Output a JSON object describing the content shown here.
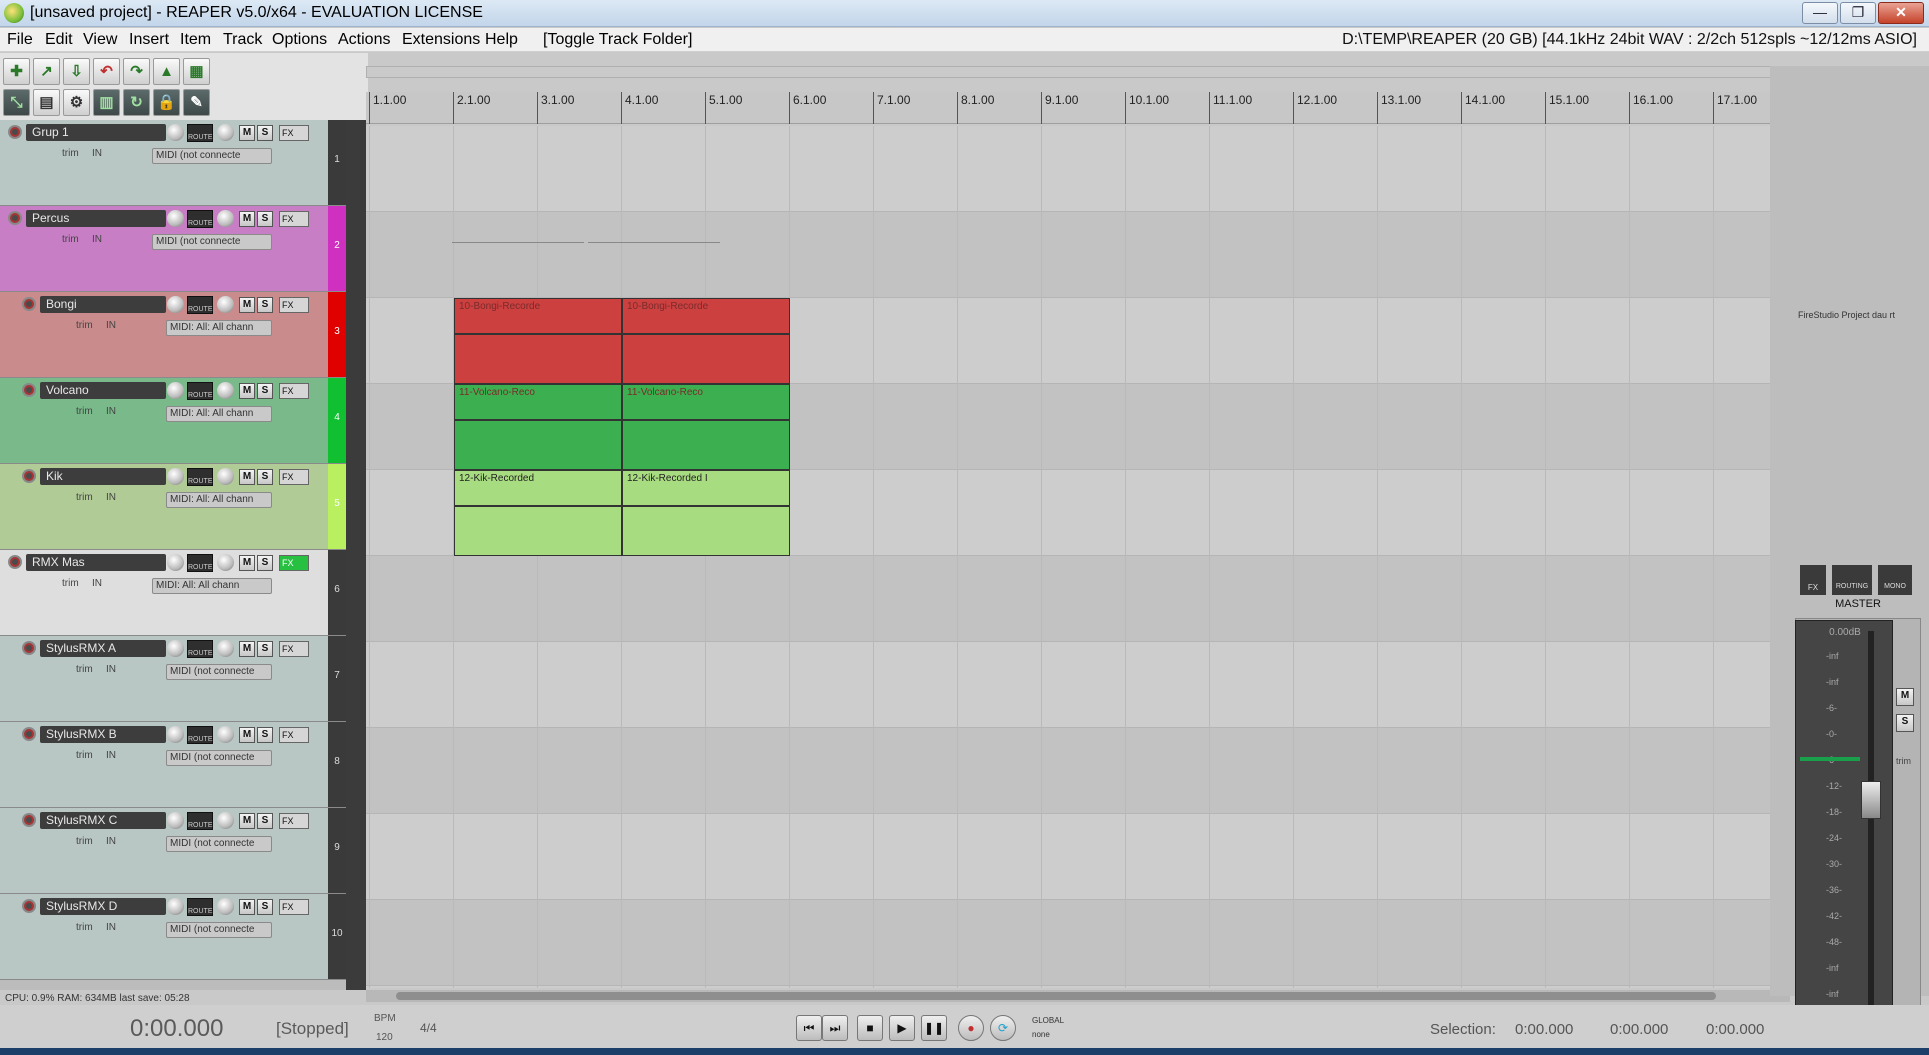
{
  "window": {
    "title": "[unsaved project] - REAPER v5.0/x64 - EVALUATION LICENSE",
    "buttons": {
      "minimize": "—",
      "maximize": "❐",
      "close": "✕"
    }
  },
  "menu": {
    "items": [
      "File",
      "Edit",
      "View",
      "Insert",
      "Item",
      "Track",
      "Options",
      "Actions",
      "Extensions",
      "Help",
      "[Toggle Track Folder]"
    ],
    "status": "D:\\TEMP\\REAPER (20 GB) [44.1kHz 24bit WAV : 2/2ch 512spls ~12/12ms ASIO]"
  },
  "ruler": {
    "labels": [
      "1.1.00",
      "2.1.00",
      "3.1.00",
      "4.1.00",
      "5.1.00",
      "6.1.00",
      "7.1.00",
      "8.1.00",
      "9.1.00",
      "10.1.00",
      "11.1.00",
      "12.1.00",
      "13.1.00",
      "14.1.00",
      "15.1.00",
      "16.1.00",
      "17.1.00"
    ]
  },
  "tracks": [
    {
      "name": "Grup 1",
      "number": "1",
      "input": "MIDI (not connecte",
      "color": "#b8c6c4",
      "bar": "#3a3a3a",
      "indent": 0
    },
    {
      "name": "Percus",
      "number": "2",
      "input": "MIDI (not connecte",
      "color": "#c77ec4",
      "bar": "#d030c0",
      "indent": 0
    },
    {
      "name": "Bongi",
      "number": "3",
      "input": "MIDI: All: All chann",
      "color": "#c98b8b",
      "bar": "#e00000",
      "indent": 1
    },
    {
      "name": "Volcano",
      "number": "4",
      "input": "MIDI: All: All chann",
      "color": "#79b98a",
      "bar": "#10c030",
      "indent": 1
    },
    {
      "name": "Kik",
      "number": "5",
      "input": "MIDI: All: All chann",
      "color": "#b0cb96",
      "bar": "#b8f060",
      "indent": 1
    },
    {
      "name": "RMX Mas",
      "number": "6",
      "input": "MIDI: All: All chann",
      "color": "#dedede",
      "bar": "#3a3a3a",
      "indent": 0
    },
    {
      "name": "StylusRMX A",
      "number": "7",
      "input": "MIDI (not connecte",
      "color": "#b8c6c4",
      "bar": "#3a3a3a",
      "indent": 1
    },
    {
      "name": "StylusRMX B",
      "number": "8",
      "input": "MIDI (not connecte",
      "color": "#b8c6c4",
      "bar": "#3a3a3a",
      "indent": 1
    },
    {
      "name": "StylusRMX C",
      "number": "9",
      "input": "MIDI (not connecte",
      "color": "#b8c6c4",
      "bar": "#3a3a3a",
      "indent": 1
    },
    {
      "name": "StylusRMX D",
      "number": "10",
      "input": "MIDI (not connecte",
      "color": "#b8c6c4",
      "bar": "#3a3a3a",
      "indent": 1
    }
  ],
  "tcp_labels": {
    "trim": "trim",
    "in": "IN",
    "route": "ROUTE",
    "mute": "M",
    "solo": "S",
    "fx": "FX"
  },
  "items": [
    {
      "track": 2,
      "label": "10-Bongi-Recorde",
      "color": "#cc4040",
      "part": 0
    },
    {
      "track": 2,
      "label": "10-Bongi-Recorde",
      "color": "#cc4040",
      "part": 1
    },
    {
      "track": 3,
      "label": "11-Volcano-Reco",
      "color": "#3cb050",
      "part": 0
    },
    {
      "track": 3,
      "label": "11-Volcano-Reco",
      "color": "#3cb050",
      "part": 1
    },
    {
      "track": 4,
      "label": "12-Kik-Recorded",
      "color": "#a8dc80",
      "part": 0
    },
    {
      "track": 4,
      "label": "12-Kik-Recorded I",
      "color": "#a8dc80",
      "part": 1
    }
  ],
  "mixer": {
    "fx_label": "FireStudio Project dau rt",
    "routing": "ROUTING",
    "mono": "MONO",
    "fx": "FX",
    "master_label": "MASTER",
    "pan": "center",
    "db": "0.00dB",
    "scale": [
      "-inf",
      "-inf",
      "-6-",
      "-0-",
      "-6-",
      "-12-",
      "-18-",
      "-24-",
      "-30-",
      "-36-",
      "-42-",
      "-48-",
      "-inf",
      "-inf"
    ],
    "m": "M",
    "s": "S",
    "trim": "trim"
  },
  "status": {
    "cpu": "CPU: 0.9% RAM: 634MB last save: 05:28"
  },
  "transport": {
    "time": "0:00.000",
    "state": "[Stopped]",
    "bpm_label": "BPM",
    "bpm": "120",
    "timesig": "4/4",
    "global": "GLOBAL",
    "none": "none",
    "selection_label": "Selection:",
    "sel_start": "0:00.000",
    "sel_end": "0:00.000",
    "sel_len": "0:00.000"
  }
}
